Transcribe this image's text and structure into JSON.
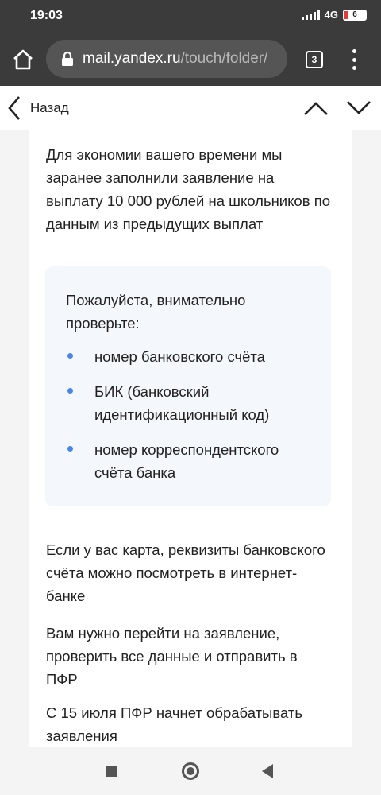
{
  "status_bar": {
    "time": "19:03",
    "network": "4G",
    "battery": "6"
  },
  "browser": {
    "url_domain": "mail.yandex.ru",
    "url_path": "/touch/folder/",
    "tab_count": "3"
  },
  "header": {
    "back_label": "Назад"
  },
  "message": {
    "intro": "Для экономии вашего времени мы заранее заполнили заявление на выплату 10 000 рублей на школьников по данным из предыдущих выплат",
    "check_title": "Пожалуйста, внимательно проверьте:",
    "check_items": [
      "номер банковского счёта",
      "БИК (банковский идентификационный код)",
      "номер корреспондентского счёта банка"
    ],
    "card_note": "Если у вас карта, реквизиты банковского счёта можно посмотреть в интернет-банке",
    "action_note": "Вам нужно перейти на заявление, проверить все данные и отправить в ПФР",
    "processing_note": "С 15 июля ПФР начнет обрабатывать заявления"
  },
  "colors": {
    "bullet": "#4a86e8",
    "info_bg": "#f4f7fc",
    "battery_low": "#e53935"
  }
}
